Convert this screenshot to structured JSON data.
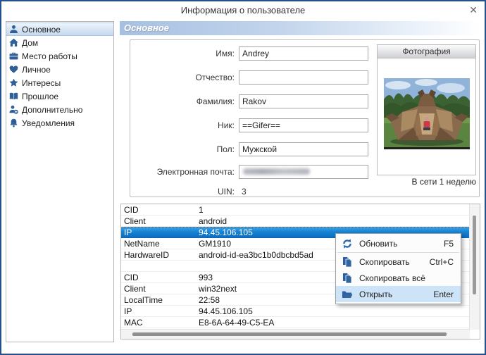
{
  "window": {
    "title": "Информация о пользователе",
    "close_glyph": "✕"
  },
  "sidebar": {
    "items": [
      {
        "label": "Основное",
        "icon": "person-icon",
        "selected": true
      },
      {
        "label": "Дом",
        "icon": "home-icon",
        "selected": false
      },
      {
        "label": "Место работы",
        "icon": "briefcase-icon",
        "selected": false
      },
      {
        "label": "Личное",
        "icon": "heart-icon",
        "selected": false
      },
      {
        "label": "Интересы",
        "icon": "star-icon",
        "selected": false
      },
      {
        "label": "Прошлое",
        "icon": "book-icon",
        "selected": false
      },
      {
        "label": "Дополнительно",
        "icon": "person-plus-icon",
        "selected": false
      },
      {
        "label": "Уведомления",
        "icon": "bell-icon",
        "selected": false
      }
    ]
  },
  "main": {
    "section_header": "Основное",
    "form": {
      "fields": [
        {
          "label": "Имя:",
          "value": "Andrey"
        },
        {
          "label": "Отчество:",
          "value": ""
        },
        {
          "label": "Фамилия:",
          "value": "Rakov"
        },
        {
          "label": "Ник:",
          "value": "==Gifer=="
        },
        {
          "label": "Пол:",
          "value": "Мужской"
        },
        {
          "label": "Электронная почта:",
          "value": ""
        },
        {
          "label": "UIN:",
          "value": "3"
        }
      ]
    },
    "photo": {
      "title": "Фотография",
      "status": "В сети 1 неделю"
    },
    "table": {
      "selected_index": 2,
      "rows": [
        [
          "CID",
          "1"
        ],
        [
          "Client",
          "android"
        ],
        [
          "IP",
          "94.45.106.105"
        ],
        [
          "NetName",
          "GM1910"
        ],
        [
          "HardwareID",
          "android-id-ea3bc1b0dbcbd5ad"
        ],
        [
          "",
          ""
        ],
        [
          "CID",
          "993"
        ],
        [
          "Client",
          "win32next"
        ],
        [
          "LocalTime",
          "22:58"
        ],
        [
          "IP",
          "94.45.106.105"
        ],
        [
          "MAC",
          "E8-6A-64-49-C5-EA"
        ]
      ]
    }
  },
  "context_menu": {
    "items": [
      {
        "label": "Обновить",
        "shortcut": "F5",
        "icon": "refresh-icon"
      },
      {
        "label": "Скопировать",
        "shortcut": "Ctrl+C",
        "icon": "copy-icon"
      },
      {
        "label": "Скопировать всё",
        "shortcut": "",
        "icon": "copy-icon"
      },
      {
        "label": "Открыть",
        "shortcut": "Enter",
        "icon": "folder-open-icon",
        "highlighted": true
      }
    ]
  },
  "colors": {
    "window_border": "#24518b",
    "icon_blue": "#2f5f96",
    "selection_blue": "#1581d2",
    "menu_highlight": "#cde3f7",
    "header_gradient_start": "#a7c0e2"
  }
}
